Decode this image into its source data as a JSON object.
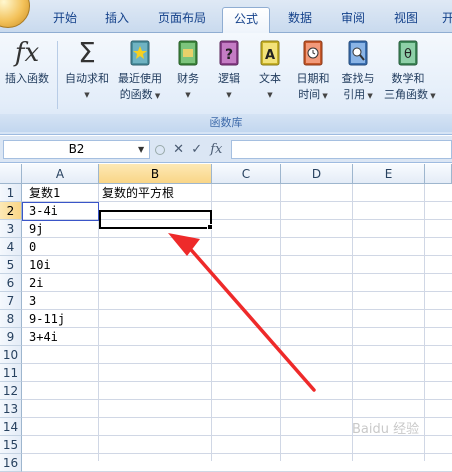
{
  "ribbon_tabs": [
    "开始",
    "插入",
    "页面布局",
    "公式",
    "数据",
    "审阅",
    "视图",
    "开"
  ],
  "active_tab": "公式",
  "ribbon": {
    "insert_function": "插入函数",
    "autosum": "自动求和",
    "recent_1": "最近使用",
    "recent_2": "的函数",
    "financial": "财务",
    "logical": "逻辑",
    "text": "文本",
    "datetime_1": "日期和",
    "datetime_2": "时间",
    "lookup_1": "查找与",
    "lookup_2": "引用",
    "math_1": "数学和",
    "math_2": "三角函数",
    "group_label": "函数库"
  },
  "formula_bar": {
    "name_box": "B2",
    "fx": "fx",
    "formula": ""
  },
  "columns": [
    "A",
    "B",
    "C",
    "D",
    "E"
  ],
  "rows": [
    "1",
    "2",
    "3",
    "4",
    "5",
    "6",
    "7",
    "8",
    "9",
    "10",
    "11",
    "12",
    "13",
    "14",
    "15",
    "16"
  ],
  "cells": {
    "A1": "复数1",
    "B1": "复数的平方根",
    "A2": "3-4i",
    "A3": "9j",
    "A4": "0",
    "A5": "10i",
    "A6": "2i",
    "A7": "3",
    "A8": "9-11j",
    "A9": "3+4i"
  },
  "selected_cell": "B2",
  "watermark": "Baidu 经验",
  "colors": {
    "accent": "#15428b",
    "arrow": "#ee2a2a",
    "selection": "#000000"
  }
}
